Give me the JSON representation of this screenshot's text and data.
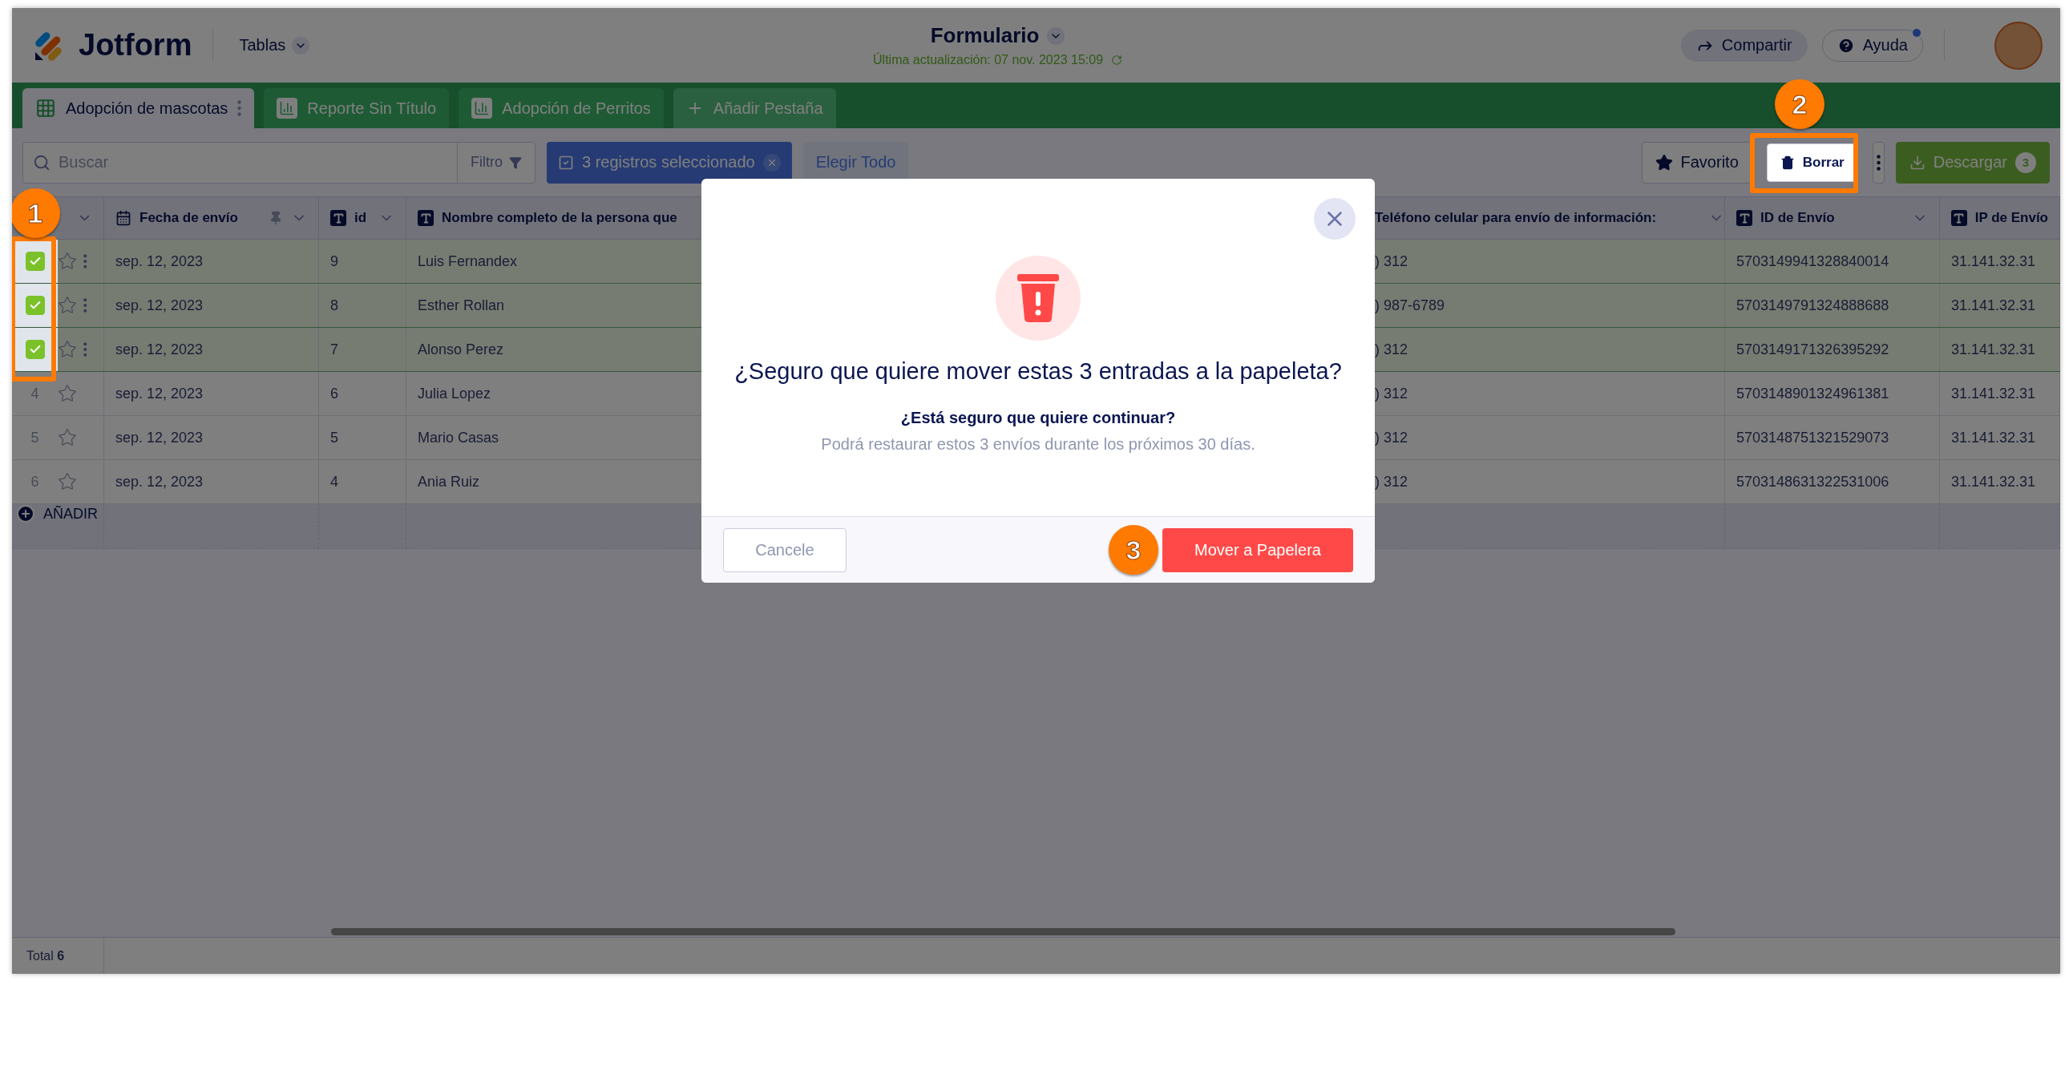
{
  "header": {
    "logo": "Jotform",
    "menu": "Tablas",
    "title": "Formulario",
    "updated": "Última actualización: 07 nov. 2023 15:09",
    "share": "Compartir",
    "help": "Ayuda",
    "help_notification": true
  },
  "tabs": [
    {
      "label": "Adopción de mascotas",
      "kind": "table",
      "selected": true
    },
    {
      "label": "Reporte Sin Título",
      "kind": "report",
      "selected": false
    },
    {
      "label": "Adopción de Perritos",
      "kind": "report",
      "selected": false
    }
  ],
  "add_tab": "Añadir Pestaña",
  "toolbar": {
    "search_placeholder": "Buscar",
    "filter": "Filtro",
    "selection": "3 registros seleccionado",
    "select_all": "Elegir Todo",
    "favorite": "Favorito",
    "delete": "Borrar",
    "download": "Descargar",
    "download_count": "3"
  },
  "table": {
    "columns": [
      {
        "label": "Fecha de envío",
        "kind": "date",
        "pinned": true,
        "menu": true
      },
      {
        "label": "id",
        "kind": "text",
        "pinned": false,
        "menu": true
      },
      {
        "label": "Nombre completo de la persona que",
        "kind": "text",
        "pinned": false,
        "menu": false
      },
      {
        "label": "Teléfono celular para envío de información:",
        "kind": "hidden",
        "pinned": false,
        "menu": true
      },
      {
        "label": "ID de Envío",
        "kind": "text",
        "pinned": false,
        "menu": true
      },
      {
        "label": "IP de Envío",
        "kind": "text",
        "pinned": false,
        "menu": false
      }
    ],
    "rows": [
      {
        "selected": true,
        "starred": false,
        "cells": [
          "sep. 12, 2023",
          "9",
          "Luis Fernandex",
          ") 312",
          "5703149941328840014",
          "31.141.32.31"
        ]
      },
      {
        "selected": true,
        "starred": false,
        "cells": [
          "sep. 12, 2023",
          "8",
          "Esther Rollan",
          ") 987-6789",
          "5703149791324888688",
          "31.141.32.31"
        ]
      },
      {
        "selected": true,
        "starred": false,
        "cells": [
          "sep. 12, 2023",
          "7",
          "Alonso Perez",
          ") 312",
          "5703149171326395292",
          "31.141.32.31"
        ]
      },
      {
        "number": "4",
        "selected": false,
        "starred": false,
        "cells": [
          "sep. 12, 2023",
          "6",
          "Julia Lopez",
          ") 312",
          "5703148901324961381",
          "31.141.32.31"
        ]
      },
      {
        "number": "5",
        "selected": false,
        "starred": false,
        "cells": [
          "sep. 12, 2023",
          "5",
          "Mario Casas",
          ") 312",
          "5703148751321529073",
          "31.141.32.31"
        ]
      },
      {
        "number": "6",
        "selected": false,
        "starred": false,
        "cells": [
          "sep. 12, 2023",
          "4",
          "Ania Ruiz",
          ") 312",
          "5703148631322531006",
          "31.141.32.31"
        ]
      }
    ],
    "add_row": "AÑADIR"
  },
  "footer": {
    "total": "Total **6**"
  },
  "dialog": {
    "title": "¿Seguro que quiere mover estas 3 entradas a la papeleta?",
    "question": "¿Está seguro que quiere continuar?",
    "note": "Podrá restaurar estos 3 envíos durante los próximos 30 días.",
    "cancel": "Cancele",
    "confirm": "Mover a Papelera"
  },
  "annotations": [
    {
      "label": "1"
    },
    {
      "label": "2"
    },
    {
      "label": "3"
    }
  ]
}
